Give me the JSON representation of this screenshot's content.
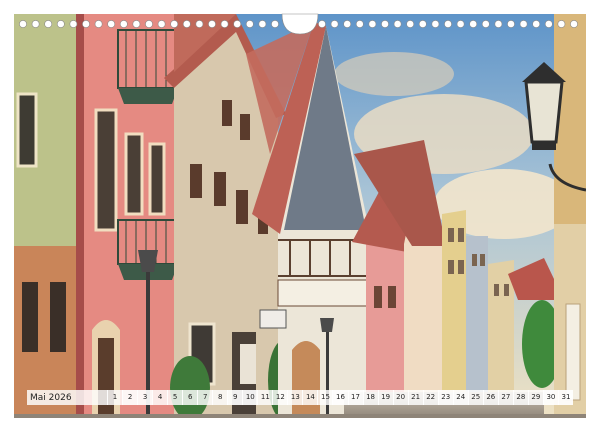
{
  "calendar": {
    "month_label": "Mai 2026",
    "days": [
      "1",
      "2",
      "3",
      "4",
      "5",
      "6",
      "7",
      "8",
      "9",
      "10",
      "11",
      "12",
      "13",
      "14",
      "15",
      "16",
      "17",
      "18",
      "19",
      "20",
      "21",
      "22",
      "23",
      "24",
      "25",
      "26",
      "27",
      "28",
      "29",
      "30",
      "31"
    ],
    "weekend_days": [
      "2",
      "3",
      "9",
      "10",
      "16",
      "17",
      "23",
      "24",
      "30",
      "31"
    ]
  },
  "photo": {
    "subject": "half-timbered-gabled-houses-street",
    "colors": {
      "sky": "#a9c4d6",
      "pink_facade": "#e58a82",
      "cream_facade": "#e0cfa6",
      "slate_gable": "#6f7a88",
      "roof_tile": "#b5544a",
      "ground": "#b9b0a4"
    }
  }
}
